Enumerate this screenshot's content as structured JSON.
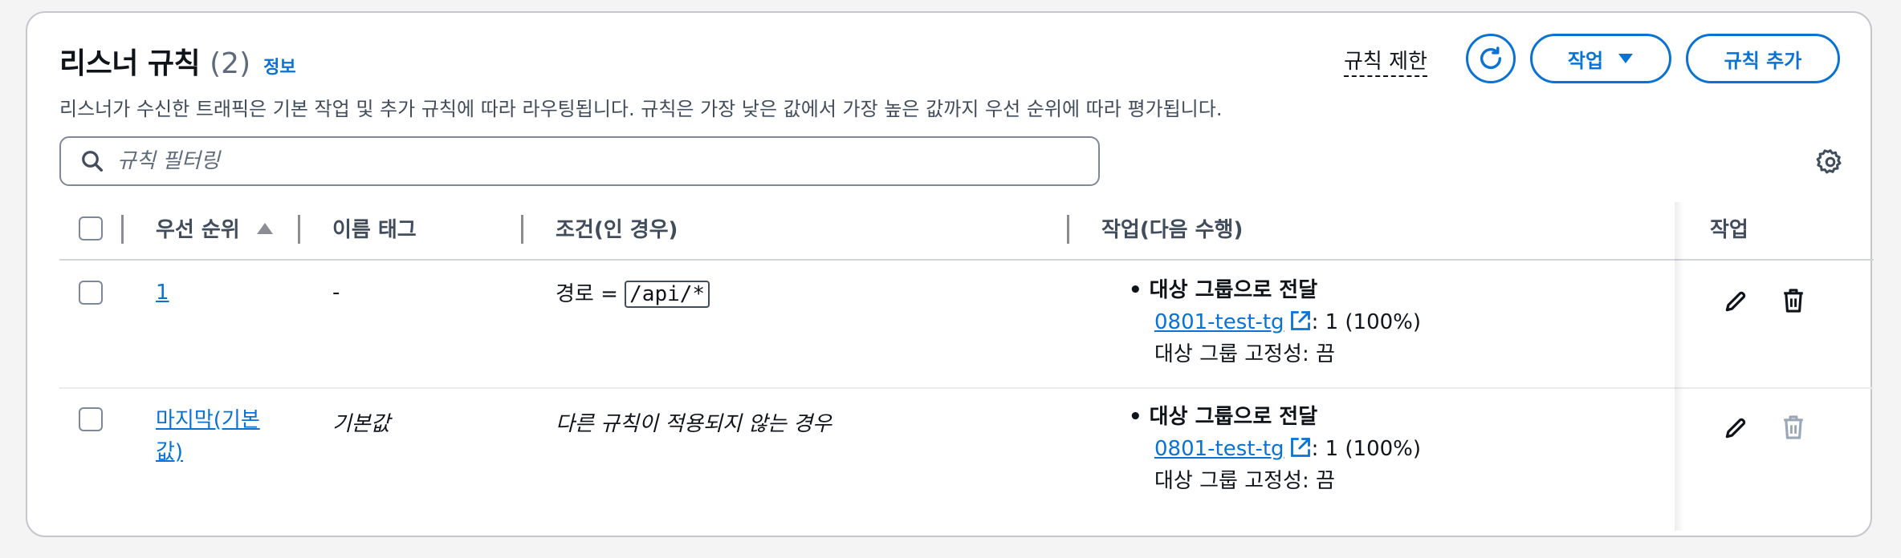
{
  "header": {
    "title": "리스너 규칙",
    "count": "(2)",
    "info": "정보",
    "description": "리스너가 수신한 트래픽은 기본 작업 및 추가 규칙에 따라 라우팅됩니다. 규칙은 가장 낮은 값에서 가장 높은 값까지 우선 순위에 따라 평가됩니다.",
    "limits_link": "규칙 제한",
    "action_button": "작업",
    "add_button": "규칙 추가"
  },
  "search": {
    "placeholder": "규칙 필터링"
  },
  "table": {
    "columns": [
      "우선 순위",
      "이름 태그",
      "조건(인 경우)",
      "작업(다음 수행)",
      "작업"
    ],
    "rows": [
      {
        "priority": "1",
        "name_tag": "-",
        "condition_prefix": "경로 =",
        "condition_value": "/api/*",
        "action_title": "대상 그룹으로 전달",
        "target_group": "0801-test-tg",
        "weight": ": 1 (100%)",
        "stickiness": "대상 그룹 고정성: 끔",
        "delete_enabled": true
      },
      {
        "priority_line1": "마지막(기본",
        "priority_line2": "값)",
        "name_tag": "기본값",
        "condition": "다른 규칙이 적용되지 않는 경우",
        "action_title": "대상 그룹으로 전달",
        "target_group": "0801-test-tg",
        "weight": ": 1 (100%)",
        "stickiness": "대상 그룹 고정성: 끔",
        "delete_enabled": false
      }
    ]
  },
  "icons": {
    "refresh": "refresh-icon",
    "dropdown": "caret-down-icon",
    "search": "search-icon",
    "settings": "gear-icon",
    "sort": "sort-ascending-icon",
    "external": "external-link-icon",
    "edit": "pencil-icon",
    "delete": "trash-icon"
  },
  "colors": {
    "accent": "#0972d3",
    "text": "#0f141a",
    "muted": "#414d5c",
    "disabled": "#9ba7b6"
  }
}
